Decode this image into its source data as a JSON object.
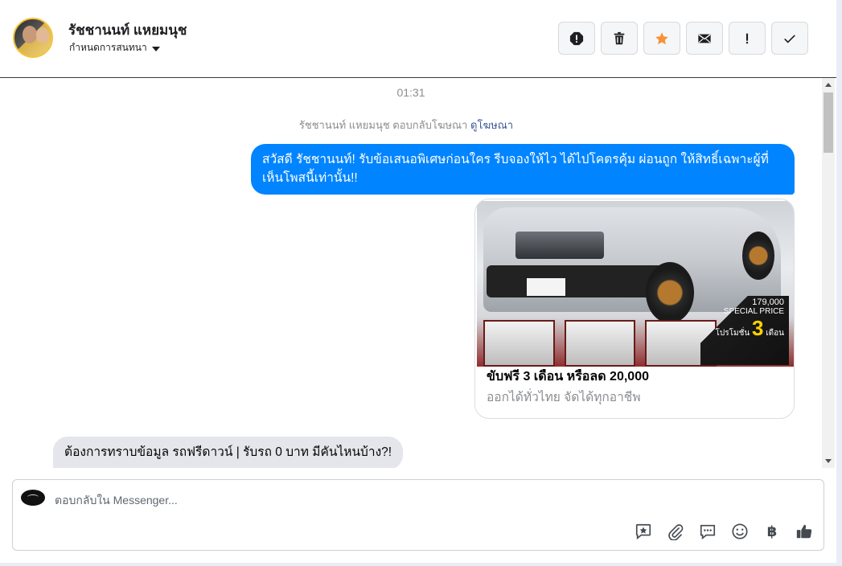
{
  "header": {
    "contact_name": "รัชชานนท์ แหยมนุช",
    "assign_label": "กำหนดการสนทนา"
  },
  "toolbar": {
    "icons": [
      "alert-icon",
      "trash-icon",
      "star-icon",
      "envelope-icon",
      "exclamation-icon",
      "check-icon"
    ],
    "star_color": "#f7923a"
  },
  "conversation": {
    "timestamp": "01:31",
    "ad_reply_text": "รัชชานนท์ แหยมนุช ตอบกลับโฆษณา",
    "ad_reply_link": "ดูโฆษณา",
    "outgoing_message": "สวัสดี รัชชานนท์! รับข้อเสนอพิเศษก่อนใคร รีบจองให้ไว ได้ไปโคตรคุ้ม ผ่อนถูก ให้สิทธิ์เฉพาะผู้ที่เห็นโพสนี้เท่านั้น!!",
    "card": {
      "title": "ขับฟรี 3 เดือน หรือลด 20,000",
      "subtitle": "ออกได้ทั่วไทย จัดได้ทุกอาชีพ",
      "image_price": "179,000",
      "image_special": "SPECIAL PRICE",
      "image_promo": "โปรโมชั่น",
      "image_months": "3",
      "image_month_label": "เดือน"
    },
    "incoming_message": "ต้องการทราบข้อมูล รถฟรีดาวน์ | รับรถ 0 บาท มีคันไหนบ้าง?!"
  },
  "composer": {
    "placeholder": "ตอบกลับใน Messenger...",
    "baht_symbol": "฿",
    "accent": "#0084ff"
  }
}
